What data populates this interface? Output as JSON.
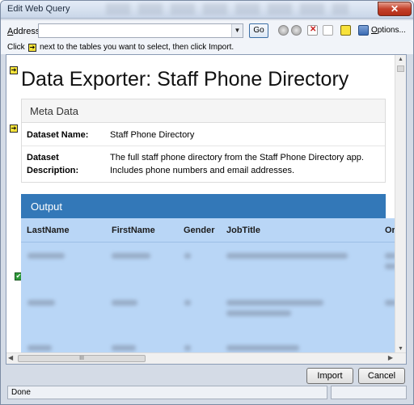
{
  "window": {
    "title": "Edit Web Query",
    "close_label": "✕"
  },
  "address": {
    "label_prefix": "A",
    "label_rest": "ddress:",
    "value": "",
    "go_label": "Go"
  },
  "toolbar": {
    "options_prefix": "O",
    "options_rest": "ptions..."
  },
  "hint": {
    "click": "Click",
    "rest": "next to the tables you want to select, then click Import."
  },
  "document": {
    "title": "Data Exporter: Staff Phone Directory",
    "meta": {
      "heading": "Meta Data",
      "rows": [
        {
          "key": "Dataset Name:",
          "value": "Staff Phone Directory"
        },
        {
          "key": "Dataset Description:",
          "value": "The full staff phone directory from the Staff Phone Directory app. Includes phone numbers and email addresses."
        }
      ]
    },
    "output": {
      "heading": "Output",
      "columns": [
        "LastName",
        "FirstName",
        "Gender",
        "JobTitle",
        "Or"
      ]
    }
  },
  "scroll": {
    "h_thumb_label": "III"
  },
  "buttons": {
    "import": "Import",
    "cancel": "Cancel"
  },
  "status": {
    "text": "Done"
  }
}
